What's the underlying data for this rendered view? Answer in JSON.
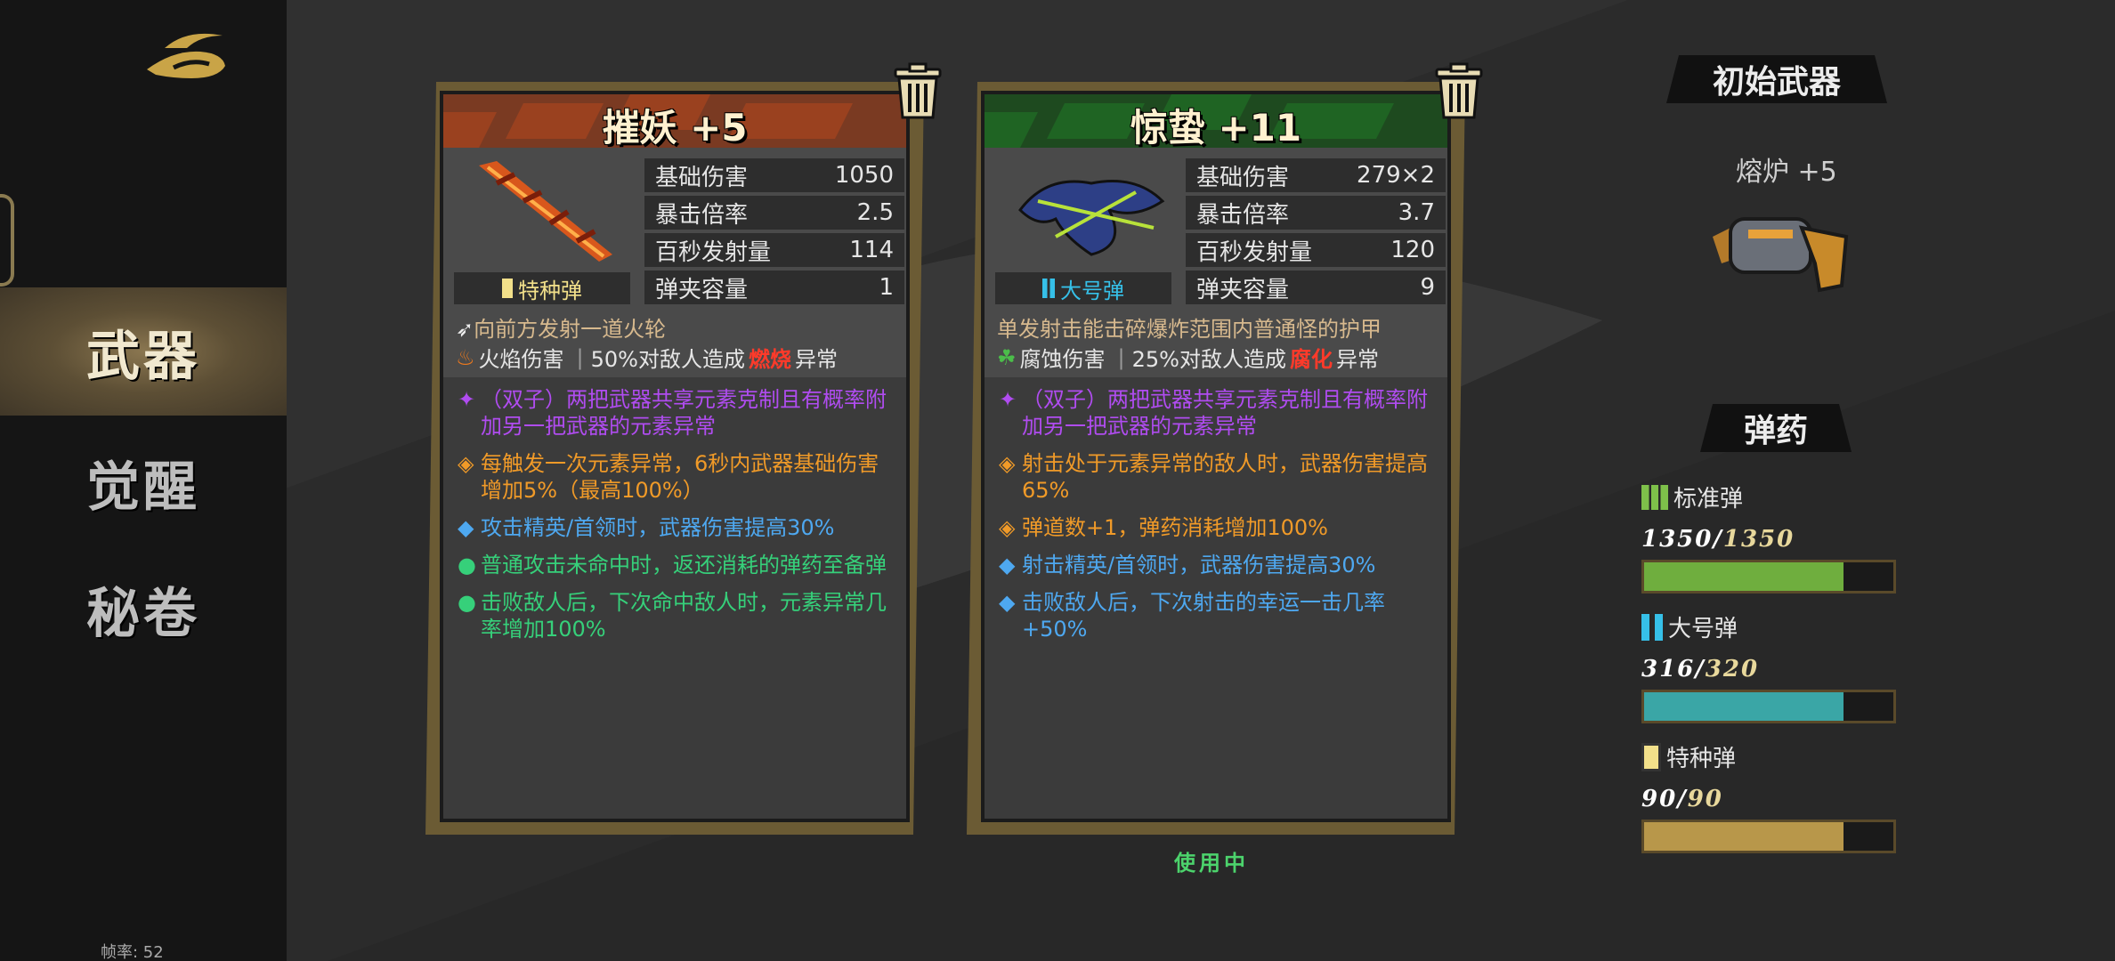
{
  "sidebar": {
    "items": [
      {
        "label": "武器",
        "active": true
      },
      {
        "label": "觉醒",
        "active": false
      },
      {
        "label": "秘卷",
        "active": false
      }
    ],
    "fps_text": "帧率: 52"
  },
  "cards": [
    {
      "title": "摧妖 +5",
      "banner_color": "#a2431f",
      "ammo_tag": "特种弹",
      "ammo_tag_color": "#f2e08a",
      "ammo_icon": "special-ammo-icon",
      "stats": [
        {
          "label": "基础伤害",
          "value": "1050"
        },
        {
          "label": "暴击倍率",
          "value": "2.5"
        },
        {
          "label": "百秒发射量",
          "value": "114"
        },
        {
          "label": "弹夹容量",
          "value": "1"
        }
      ],
      "description": "向前方发射一道火轮",
      "element_name": "火焰伤害",
      "element_icon": "flame-icon",
      "element_effect_prefix": "50%对敌人造成",
      "element_effect_highlight": "燃烧",
      "element_effect_suffix": "异常",
      "traits": [
        {
          "bullet": "✦",
          "color": "purple",
          "text": "（双子）两把武器共享元素克制且有概率附加另一把武器的元素异常"
        },
        {
          "bullet": "◈",
          "color": "orange",
          "text": "每触发一次元素异常，6秒内武器基础伤害增加5%（最高100%）"
        },
        {
          "bullet": "◆",
          "color": "blue",
          "text": "攻击精英/首领时，武器伤害提高30%"
        },
        {
          "bullet": "●",
          "color": "green",
          "text": "普通攻击未命中时，返还消耗的弹药至备弹"
        },
        {
          "bullet": "●",
          "color": "green",
          "text": "击败敌人后，下次命中敌人时，元素异常几率增加100%"
        }
      ]
    },
    {
      "title": "惊蛰 +11",
      "banner_color": "#1f6a24",
      "ammo_tag": "大号弹",
      "ammo_tag_color": "#36c0e8",
      "ammo_icon": "large-ammo-icon",
      "stats": [
        {
          "label": "基础伤害",
          "value": "279×2"
        },
        {
          "label": "暴击倍率",
          "value": "3.7"
        },
        {
          "label": "百秒发射量",
          "value": "120"
        },
        {
          "label": "弹夹容量",
          "value": "9"
        }
      ],
      "description": "单发射击能击碎爆炸范围内普通怪的护甲",
      "element_name": "腐蚀伤害",
      "element_icon": "corrosion-icon",
      "element_effect_prefix": "25%对敌人造成",
      "element_effect_highlight": "腐化",
      "element_effect_suffix": "异常",
      "traits": [
        {
          "bullet": "✦",
          "color": "purple",
          "text": "（双子）两把武器共享元素克制且有概率附加另一把武器的元素异常"
        },
        {
          "bullet": "◈",
          "color": "orange",
          "text": "射击处于元素异常的敌人时，武器伤害提高65%"
        },
        {
          "bullet": "◈",
          "color": "orange",
          "text": "弹道数+1，弹药消耗增加100%"
        },
        {
          "bullet": "◆",
          "color": "blue",
          "text": "射击精英/首领时，武器伤害提高30%"
        },
        {
          "bullet": "◆",
          "color": "blue",
          "text": "击败敌人后，下次射击的幸运一击几率+50%"
        }
      ]
    }
  ],
  "in_use_label": "使用中",
  "initial_weapon": {
    "header": "初始武器",
    "name": "熔炉 +5"
  },
  "ammo": {
    "header": "弹药",
    "items": [
      {
        "name": "标准弹",
        "icon": "standard-ammo-icon",
        "current": "1350",
        "max": "1350",
        "fraction": 0.8,
        "color": "#6fae3e"
      },
      {
        "name": "大号弹",
        "icon": "large-ammo-icon",
        "current": "316",
        "max": "320",
        "fraction": 0.8,
        "color": "#3aa6a6"
      },
      {
        "name": "特种弹",
        "icon": "special-ammo-icon",
        "current": "90",
        "max": "90",
        "fraction": 0.8,
        "color": "#b8974a"
      }
    ]
  }
}
